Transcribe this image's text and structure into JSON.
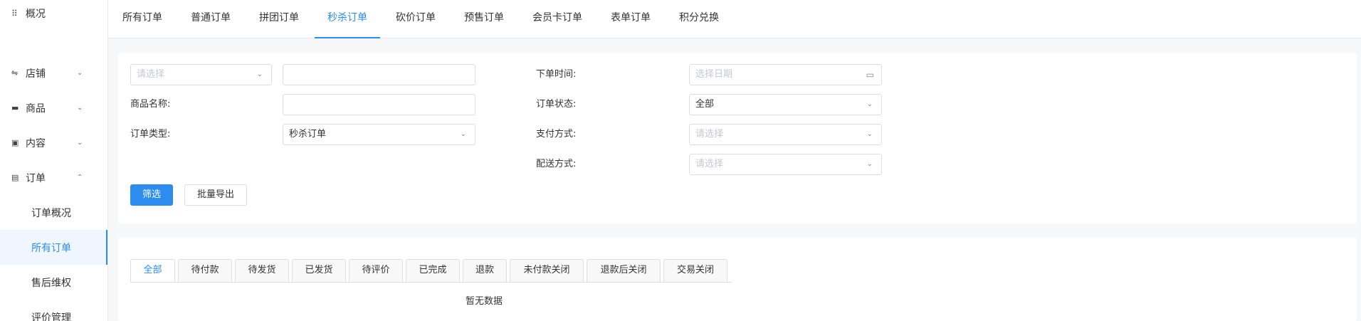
{
  "sidebar": {
    "overview": {
      "icon": "grid-icon",
      "label": "概况"
    },
    "groups": [
      {
        "icon": "sliders-icon",
        "label": "店铺",
        "chevron": "chevron-down-icon"
      },
      {
        "icon": "product-icon",
        "label": "商品",
        "chevron": "chevron-down-icon"
      },
      {
        "icon": "content-icon",
        "label": "内容",
        "chevron": "chevron-down-icon"
      },
      {
        "icon": "order-icon",
        "label": "订单",
        "chevron": "chevron-up-icon"
      }
    ],
    "subitems": [
      "订单概况",
      "所有订单",
      "售后维权",
      "评价管理"
    ],
    "active_sub": "所有订单"
  },
  "top_tabs": [
    "所有订单",
    "普通订单",
    "拼团订单",
    "秒杀订单",
    "砍价订单",
    "预售订单",
    "会员卡订单",
    "表单订单",
    "积分兑换"
  ],
  "active_top_tab": "秒杀订单",
  "filter": {
    "search_type_placeholder": "请选择",
    "search_value": "",
    "goods_name_label": "商品名称:",
    "goods_name_value": "",
    "order_type_label": "订单类型:",
    "order_type_value": "秒杀订单",
    "order_time_label": "下单时间:",
    "order_time_placeholder": "选择日期",
    "order_status_label": "订单状态:",
    "order_status_value": "全部",
    "pay_method_label": "支付方式:",
    "pay_method_placeholder": "请选择",
    "delivery_method_label": "配送方式:",
    "delivery_method_placeholder": "请选择",
    "filter_button": "筛选",
    "export_button": "批量导出"
  },
  "status_tabs": [
    "全部",
    "待付款",
    "待发货",
    "已发货",
    "待评价",
    "已完成",
    "退款",
    "未付款关闭",
    "退款后关闭",
    "交易关闭"
  ],
  "active_status_tab": "全部",
  "empty_text": "暂无数据",
  "colors": {
    "accent": "#2d8cf0",
    "border": "#dcdee2",
    "background": "#f5f7f9"
  }
}
